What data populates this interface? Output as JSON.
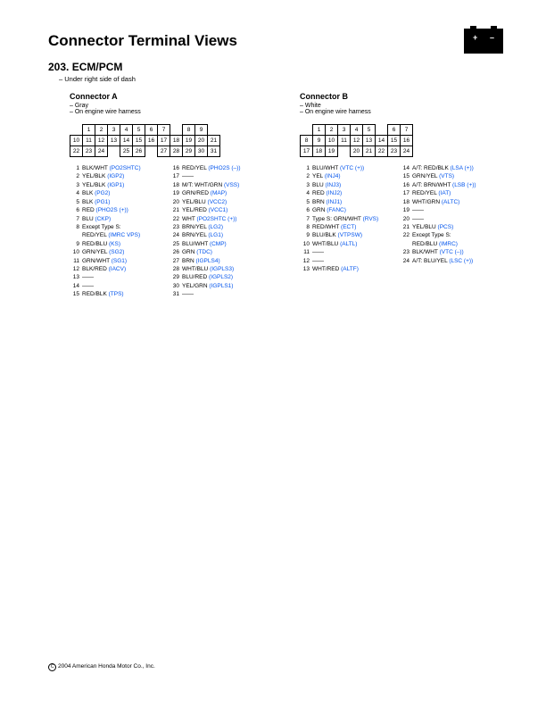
{
  "title": "Connector Terminal Views",
  "section": {
    "num": "203.",
    "name": "ECM/PCM",
    "loc": "– Under right side of dash"
  },
  "footer": "2004 American Honda Motor Co., Inc.",
  "connA": {
    "title": "Connector A",
    "color": "– Gray",
    "harness": "– On engine wire harness",
    "rows": [
      [
        null,
        "1",
        "2",
        "3",
        "4",
        "5",
        "6",
        "7",
        null,
        "8",
        "9",
        null
      ],
      [
        "10",
        "11",
        "12",
        "13",
        "14",
        "15",
        "16",
        "17",
        "18",
        "19",
        "20",
        "21"
      ],
      [
        "22",
        "23",
        "24",
        null,
        "25",
        "26",
        null,
        "27",
        "28",
        "29",
        "30",
        "31"
      ]
    ],
    "pins": [
      [
        [
          "1",
          "BLK/WHT",
          "(PO2SHTC)"
        ],
        [
          "2",
          "YEL/BLK",
          "(IGP2)"
        ],
        [
          "3",
          "YEL/BLK",
          "(IGP1)"
        ],
        [
          "4",
          "BLK",
          "(PG2)"
        ],
        [
          "5",
          "BLK",
          "(PG1)"
        ],
        [
          "6",
          "RED",
          "(PHO2S (+))"
        ],
        [
          "7",
          "BLU",
          "(CKP)"
        ],
        [
          "8",
          "Except Type S:",
          ""
        ],
        [
          "",
          "  RED/YEL",
          "(IMRC VPS)"
        ],
        [
          "9",
          "RED/BLU",
          "(KS)"
        ],
        [
          "10",
          "GRN/YEL",
          "(SG2)"
        ],
        [
          "11",
          "GRN/WHT",
          "(SG1)"
        ],
        [
          "12",
          "BLK/RED",
          "(IACV)"
        ],
        [
          "13",
          "——",
          ""
        ],
        [
          "14",
          "——",
          ""
        ],
        [
          "15",
          "RED/BLK",
          "(TPS)"
        ]
      ],
      [
        [
          "16",
          "RED/YEL",
          "(PHO2S (–))"
        ],
        [
          "17",
          "——",
          ""
        ],
        [
          "18",
          "M/T: WHT/GRN",
          "(VSS)"
        ],
        [
          "19",
          "GRN/RED",
          "(MAP)"
        ],
        [
          "20",
          "YEL/BLU",
          "(VCC2)"
        ],
        [
          "21",
          "YEL/RED",
          "(VCC1)"
        ],
        [
          "22",
          "WHT",
          "(PO2SHTC (+))"
        ],
        [
          "23",
          "BRN/YEL",
          "(LG2)"
        ],
        [
          "24",
          "BRN/YEL",
          "(LG1)"
        ],
        [
          "25",
          "BLU/WHT",
          "(CMP)"
        ],
        [
          "26",
          "GRN",
          "(TDC)"
        ],
        [
          "27",
          "BRN",
          "(IGPLS4)"
        ],
        [
          "28",
          "WHT/BLU",
          "(IGPLS3)"
        ],
        [
          "29",
          "BLU/RED",
          "(IGPLS2)"
        ],
        [
          "30",
          "YEL/GRN",
          "(IGPLS1)"
        ],
        [
          "31",
          "——",
          ""
        ]
      ]
    ]
  },
  "connB": {
    "title": "Connector B",
    "color": "– White",
    "harness": "– On engine wire harness",
    "rows": [
      [
        null,
        "1",
        "2",
        "3",
        "4",
        "5",
        null,
        "6",
        "7",
        null
      ],
      [
        "8",
        "9",
        "10",
        "11",
        "12",
        "13",
        "14",
        "15",
        "16"
      ],
      [
        "17",
        "18",
        "19",
        null,
        "20",
        "21",
        "22",
        "23",
        "24"
      ]
    ],
    "pins": [
      [
        [
          "1",
          "BLU/WHT",
          "(VTC (+))"
        ],
        [
          "2",
          "YEL",
          "(INJ4)"
        ],
        [
          "3",
          "BLU",
          "(INJ3)"
        ],
        [
          "4",
          "RED",
          "(INJ2)"
        ],
        [
          "5",
          "BRN",
          "(INJ1)"
        ],
        [
          "6",
          "GRN",
          "(FANC)"
        ],
        [
          "7",
          "Type S: GRN/WHT",
          "(RVS)"
        ],
        [
          "8",
          "RED/WHT",
          "(ECT)"
        ],
        [
          "9",
          "BLU/BLK",
          "(VTPSW)"
        ],
        [
          "10",
          "WHT/BLU",
          "(ALTL)"
        ],
        [
          "11",
          "——",
          ""
        ],
        [
          "12",
          "——",
          ""
        ],
        [
          "13",
          "WHT/RED",
          "(ALTF)"
        ]
      ],
      [
        [
          "14",
          "A/T: RED/BLK",
          "(LSA (+))"
        ],
        [
          "15",
          "GRN/YEL",
          "(VTS)"
        ],
        [
          "16",
          "A/T: BRN/WHT",
          "(LSB (+))"
        ],
        [
          "17",
          "RED/YEL",
          "(IAT)"
        ],
        [
          "18",
          "WHT/GRN",
          "(ALTC)"
        ],
        [
          "19",
          "——",
          ""
        ],
        [
          "20",
          "——",
          ""
        ],
        [
          "21",
          "YEL/BLU",
          "(PCS)"
        ],
        [
          "22",
          "Except Type S:",
          ""
        ],
        [
          "",
          "  RED/BLU",
          "(IMRC)"
        ],
        [
          "23",
          "BLK/WHT",
          "(VTC (–))"
        ],
        [
          "24",
          "A/T: BLU/YEL",
          "(LSC (+))"
        ]
      ]
    ]
  }
}
